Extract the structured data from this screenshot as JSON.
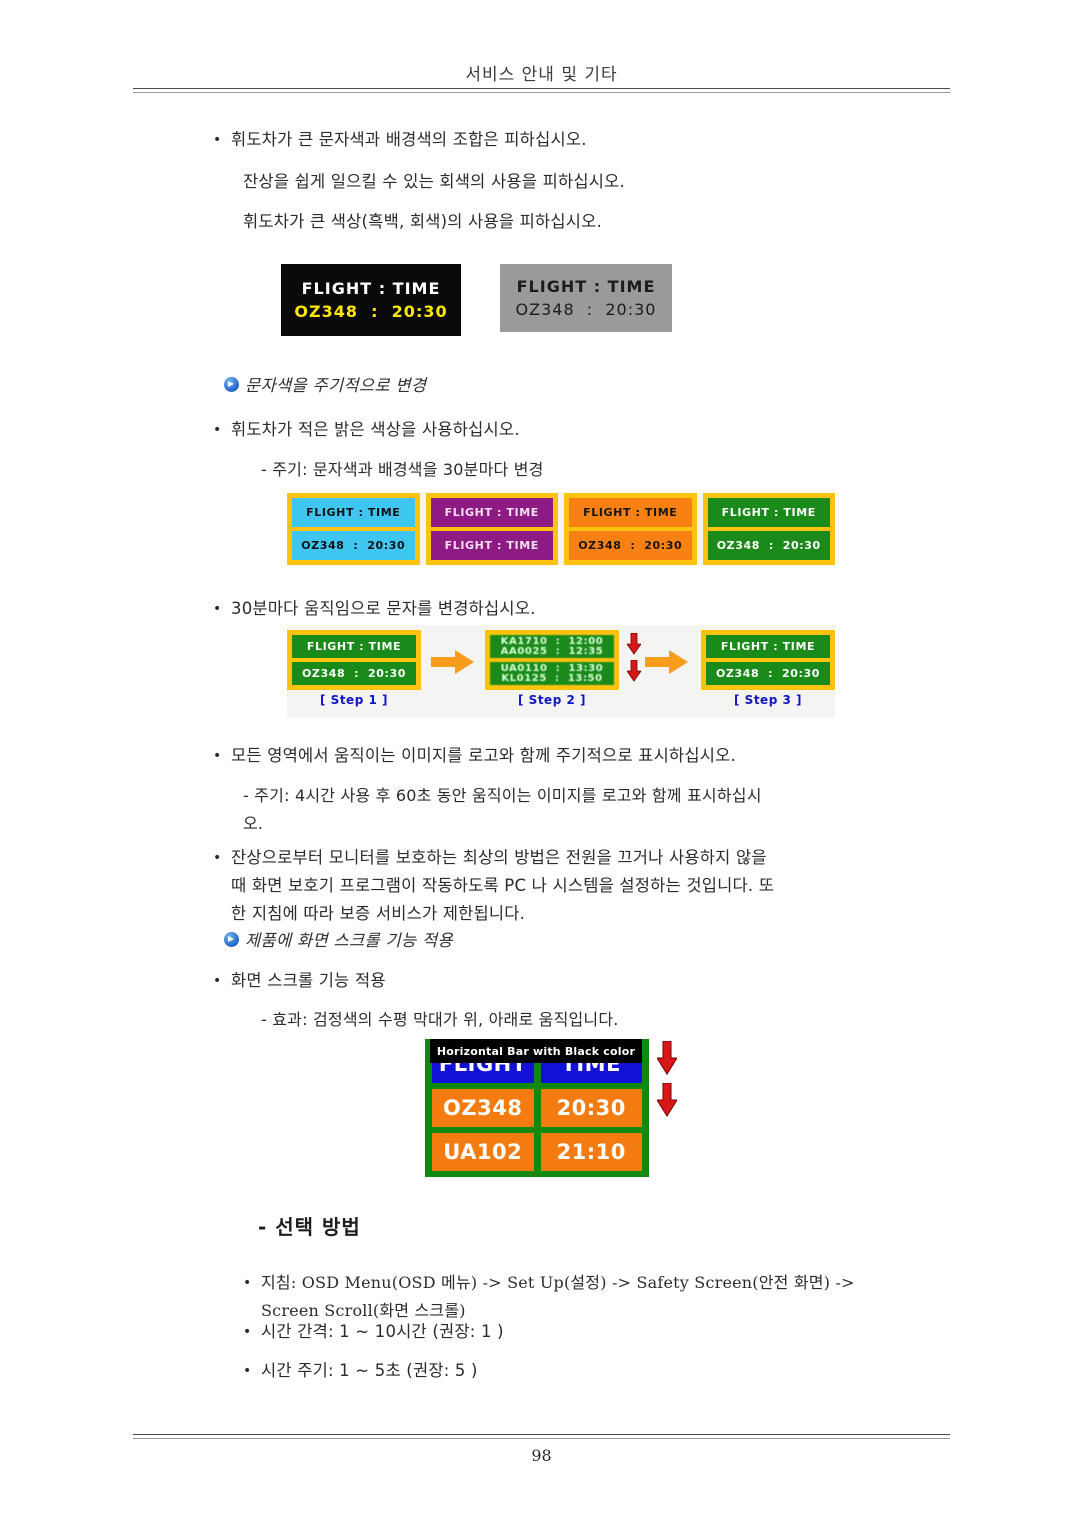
{
  "header": {
    "title": "서비스 안내 및 기타"
  },
  "footer": {
    "page_number": "98"
  },
  "body": {
    "b1": "휘도차가 큰 문자색과 배경색의 조합은 피하십시오.",
    "b1_line2": "잔상을 쉽게 일으킬 수 있는 회색의 사용을 피하십시오.",
    "b1_line3": "휘도차가 큰 색상(흑백, 회색)의 사용을 피하십시오.",
    "section1_title": "문자색을 주기적으로 변경",
    "b2": "휘도차가 적은 밝은 색상을 사용하십시오.",
    "b2_dash": "- 주기: 문자색과 배경색을 30분마다 변경",
    "b3": "30분마다 움직임으로 문자를 변경하십시오.",
    "b4": "모든 영역에서 움직이는 이미지를 로고와 함께 주기적으로 표시하십시오.",
    "b4_dash": "- 주기: 4시간 사용 후 60초 동안 움직이는 이미지를 로고와 함께 표시하십시\n오.",
    "b5": "잔상으로부터 모니터를 보호하는 최상의 방법은 전원을 끄거나 사용하지 않을\n때 화면 보호기 프로그램이 작동하도록 PC 나 시스템을 설정하는 것입니다. 또\n한 지침에 따라 보증 서비스가 제한됩니다.",
    "section2_title": "제품에 화면 스크롤 기능 적용",
    "b6": "화면 스크롤 기능 적용",
    "b6_dash": "- 효과: 검정색의 수평 막대가 위, 아래로 움직입니다.",
    "sub_heading": "- 선택 방법",
    "b7": "지침: OSD Menu(OSD 메뉴) -> Set Up(설정) -> Safety Screen(안전 화면) ->\nScreen Scroll(화면 스크롤)",
    "b8": "시간 간격: 1 ~ 10시간 (권장: 1 )",
    "b9": "시간 주기: 1 ~ 5초 (권장: 5 )",
    "bullet_glyph": "•"
  },
  "figures": {
    "fig1": {
      "panels": [
        {
          "name": "black-panel",
          "line1": "FLIGHT : TIME",
          "line2": "OZ348  :  20:30",
          "bg": "#0a0a0a",
          "line1_color": "#ffffff",
          "line2_color": "#ffe600"
        },
        {
          "name": "gray-panel",
          "line1": "FLIGHT : TIME",
          "line2": "OZ348  :  20:30",
          "bg": "#9a9a9a",
          "line1_color": "#1c1c1c",
          "line2_color": "#1c1c1c"
        }
      ]
    },
    "fig2": {
      "border_color": "#ffc20e",
      "panels": [
        {
          "name": "cyan",
          "bg": "#3ec6f0",
          "fg": "#111111",
          "line1": "FLIGHT : TIME",
          "line2": "OZ348  :  20:30"
        },
        {
          "name": "purple",
          "bg": "#8e1b84",
          "fg": "#f4dff4",
          "line1": "FLIGHT : TIME",
          "line2": "FLIGHT : TIME"
        },
        {
          "name": "orange",
          "bg": "#f98012",
          "fg": "#161616",
          "line1": "FLIGHT : TIME",
          "line2": "OZ348  :  20:30"
        },
        {
          "name": "green",
          "bg": "#1a8a1a",
          "fg": "#ffffff",
          "line1": "FLIGHT : TIME",
          "line2": "OZ348  :  20:30"
        }
      ]
    },
    "fig3": {
      "border_color": "#ffc20e",
      "cell_bg": "#1a8a1a",
      "arrow_color": "#f89c1c",
      "red_arrow_color": "#d81818",
      "steps": [
        {
          "label": "[ Step 1 ]",
          "line1": "FLIGHT : TIME",
          "line2": "OZ348  :  20:30"
        },
        {
          "label": "[ Step 2 ]",
          "line1_a": "KA1710  :  12:00",
          "line1_b": "AA0025  :  12:35",
          "line2_a": "UA0110  :  13:30",
          "line2_b": "KL0125  :  13:50"
        },
        {
          "label": "[ Step 3 ]",
          "line1": "FLIGHT : TIME",
          "line2": "OZ348  :  20:30"
        }
      ]
    },
    "fig4": {
      "bar_label": "Horizontal Bar with Black color",
      "bar_bg": "#000000",
      "panel_bg": "#0f8a0f",
      "header_row_bg": "#1111d8",
      "data_row_bg": "#f47b10",
      "rows": [
        {
          "left": "FLIGHT",
          "right": "TIME"
        },
        {
          "left": "OZ348",
          "right": "20:30"
        },
        {
          "left": "UA102",
          "right": "21:10"
        }
      ],
      "arrow_color": "#d81818"
    }
  }
}
